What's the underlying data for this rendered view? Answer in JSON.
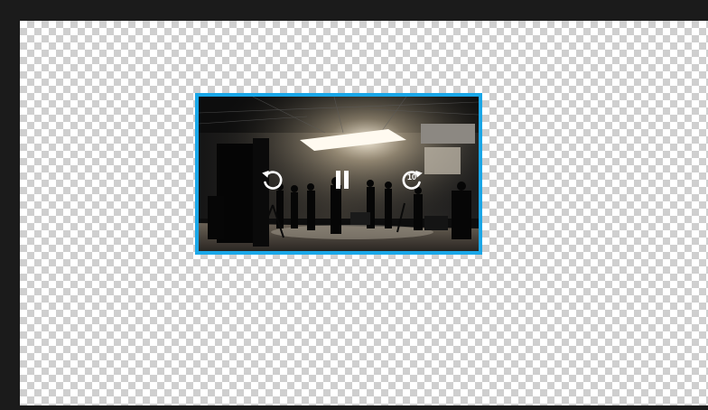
{
  "player": {
    "rewind_icon": "rewind-icon",
    "pause_icon": "pause-icon",
    "forward_icon": "fast-forward-10-icon",
    "forward_seconds": "10"
  },
  "colors": {
    "selection_border": "#1aa7e8",
    "workspace_background": "#1b1b1b",
    "checker_dark": "#cfcfcf",
    "checker_light": "#ffffff"
  }
}
